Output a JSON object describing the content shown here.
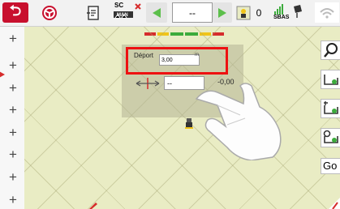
{
  "topbar": {
    "nav_value": "--",
    "field_count": "0",
    "sc_label": "SC",
    "man_label": "MAN",
    "gps_label": "SBAS"
  },
  "offset_dialog": {
    "label": "Déport",
    "value": "3,00",
    "unit": "m"
  },
  "width_row": {
    "input_value": "--",
    "value": "-0,00"
  },
  "right_panel": {
    "go_label": "Go"
  },
  "colors": {
    "back": "#c8102e",
    "highlight": "#e11111",
    "arrow_green": "#5cbf4b",
    "map_bg": "#e9ecc4",
    "colorbar": [
      "#d62c2c",
      "#f0c419",
      "#3cab3c",
      "#3cab3c",
      "#f0c419",
      "#d62c2c"
    ]
  },
  "icons": [
    "back-icon",
    "steering-icon",
    "document-icon",
    "sc-man-icon",
    "arrow-left-icon",
    "arrow-right-icon",
    "field-icon",
    "gps-signal-icon",
    "wifi-icon",
    "plus-icon",
    "search-icon",
    "guide-line-icon",
    "guide-pivot-icon",
    "guide-settings-icon",
    "tractor-icon",
    "hand-pointer-icon"
  ]
}
